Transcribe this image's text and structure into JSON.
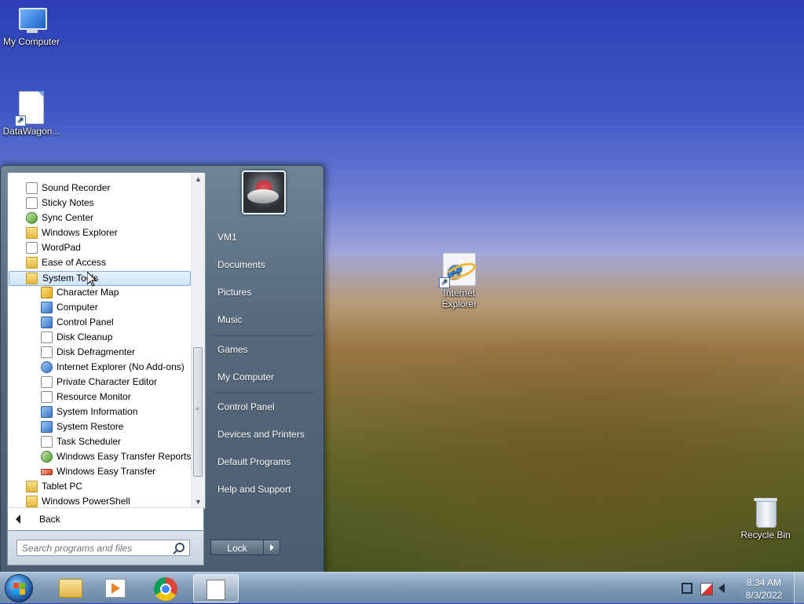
{
  "desktop": {
    "icons": [
      {
        "label": "My Computer",
        "icon": "computer-icon"
      },
      {
        "label": "DataWagon...",
        "icon": "document-shortcut-icon"
      },
      {
        "label": "Internet Explorer",
        "icon": "internet-explorer-icon"
      },
      {
        "label": "Recycle Bin",
        "icon": "recycle-bin-icon"
      }
    ]
  },
  "start_menu": {
    "programs": [
      {
        "label": "Sound Recorder",
        "icon": "microphone-icon"
      },
      {
        "label": "Sticky Notes",
        "icon": "sticky-notes-icon"
      },
      {
        "label": "Sync Center",
        "icon": "sync-icon"
      },
      {
        "label": "Windows Explorer",
        "icon": "folder-icon"
      },
      {
        "label": "WordPad",
        "icon": "wordpad-icon"
      },
      {
        "label": "Ease of Access",
        "icon": "folder-icon"
      },
      {
        "label": "System Tools",
        "icon": "folder-icon",
        "selected": true
      },
      {
        "label": "Character Map",
        "icon": "character-map-icon"
      },
      {
        "label": "Computer",
        "icon": "computer-icon"
      },
      {
        "label": "Control Panel",
        "icon": "control-panel-icon"
      },
      {
        "label": "Disk Cleanup",
        "icon": "disk-cleanup-icon"
      },
      {
        "label": "Disk Defragmenter",
        "icon": "defragmenter-icon"
      },
      {
        "label": "Internet Explorer (No Add-ons)",
        "icon": "internet-explorer-icon"
      },
      {
        "label": "Private Character Editor",
        "icon": "character-editor-icon"
      },
      {
        "label": "Resource Monitor",
        "icon": "resource-monitor-icon"
      },
      {
        "label": "System Information",
        "icon": "system-information-icon"
      },
      {
        "label": "System Restore",
        "icon": "system-restore-icon"
      },
      {
        "label": "Task Scheduler",
        "icon": "task-scheduler-icon"
      },
      {
        "label": "Windows Easy Transfer Reports",
        "icon": "easy-transfer-reports-icon"
      },
      {
        "label": "Windows Easy Transfer",
        "icon": "easy-transfer-icon"
      },
      {
        "label": "Tablet PC",
        "icon": "folder-icon"
      },
      {
        "label": "Windows PowerShell",
        "icon": "folder-icon"
      }
    ],
    "back_label": "Back",
    "search_placeholder": "Search programs and files",
    "right_items": {
      "user": "VM1",
      "documents": "Documents",
      "pictures": "Pictures",
      "music": "Music",
      "games": "Games",
      "my_computer": "My Computer",
      "control_panel": "Control Panel",
      "devices": "Devices and Printers",
      "default_programs": "Default Programs",
      "help": "Help and Support"
    },
    "lock_label": "Lock"
  },
  "taskbar": {
    "pinned": [
      {
        "name": "windows-explorer-taskbar-button",
        "icon": "folder-icon"
      },
      {
        "name": "media-player-taskbar-button",
        "icon": "media-player-icon"
      },
      {
        "name": "chrome-taskbar-button",
        "icon": "chrome-icon"
      },
      {
        "name": "app-taskbar-button",
        "icon": "application-icon",
        "active": true
      }
    ],
    "clock_time": "8:34 AM",
    "clock_date": "8/3/2022"
  },
  "colors": {
    "selection": "#cfe3f8",
    "start_menu_glass": "#56697c",
    "taskbar": "#7f9cb8"
  }
}
